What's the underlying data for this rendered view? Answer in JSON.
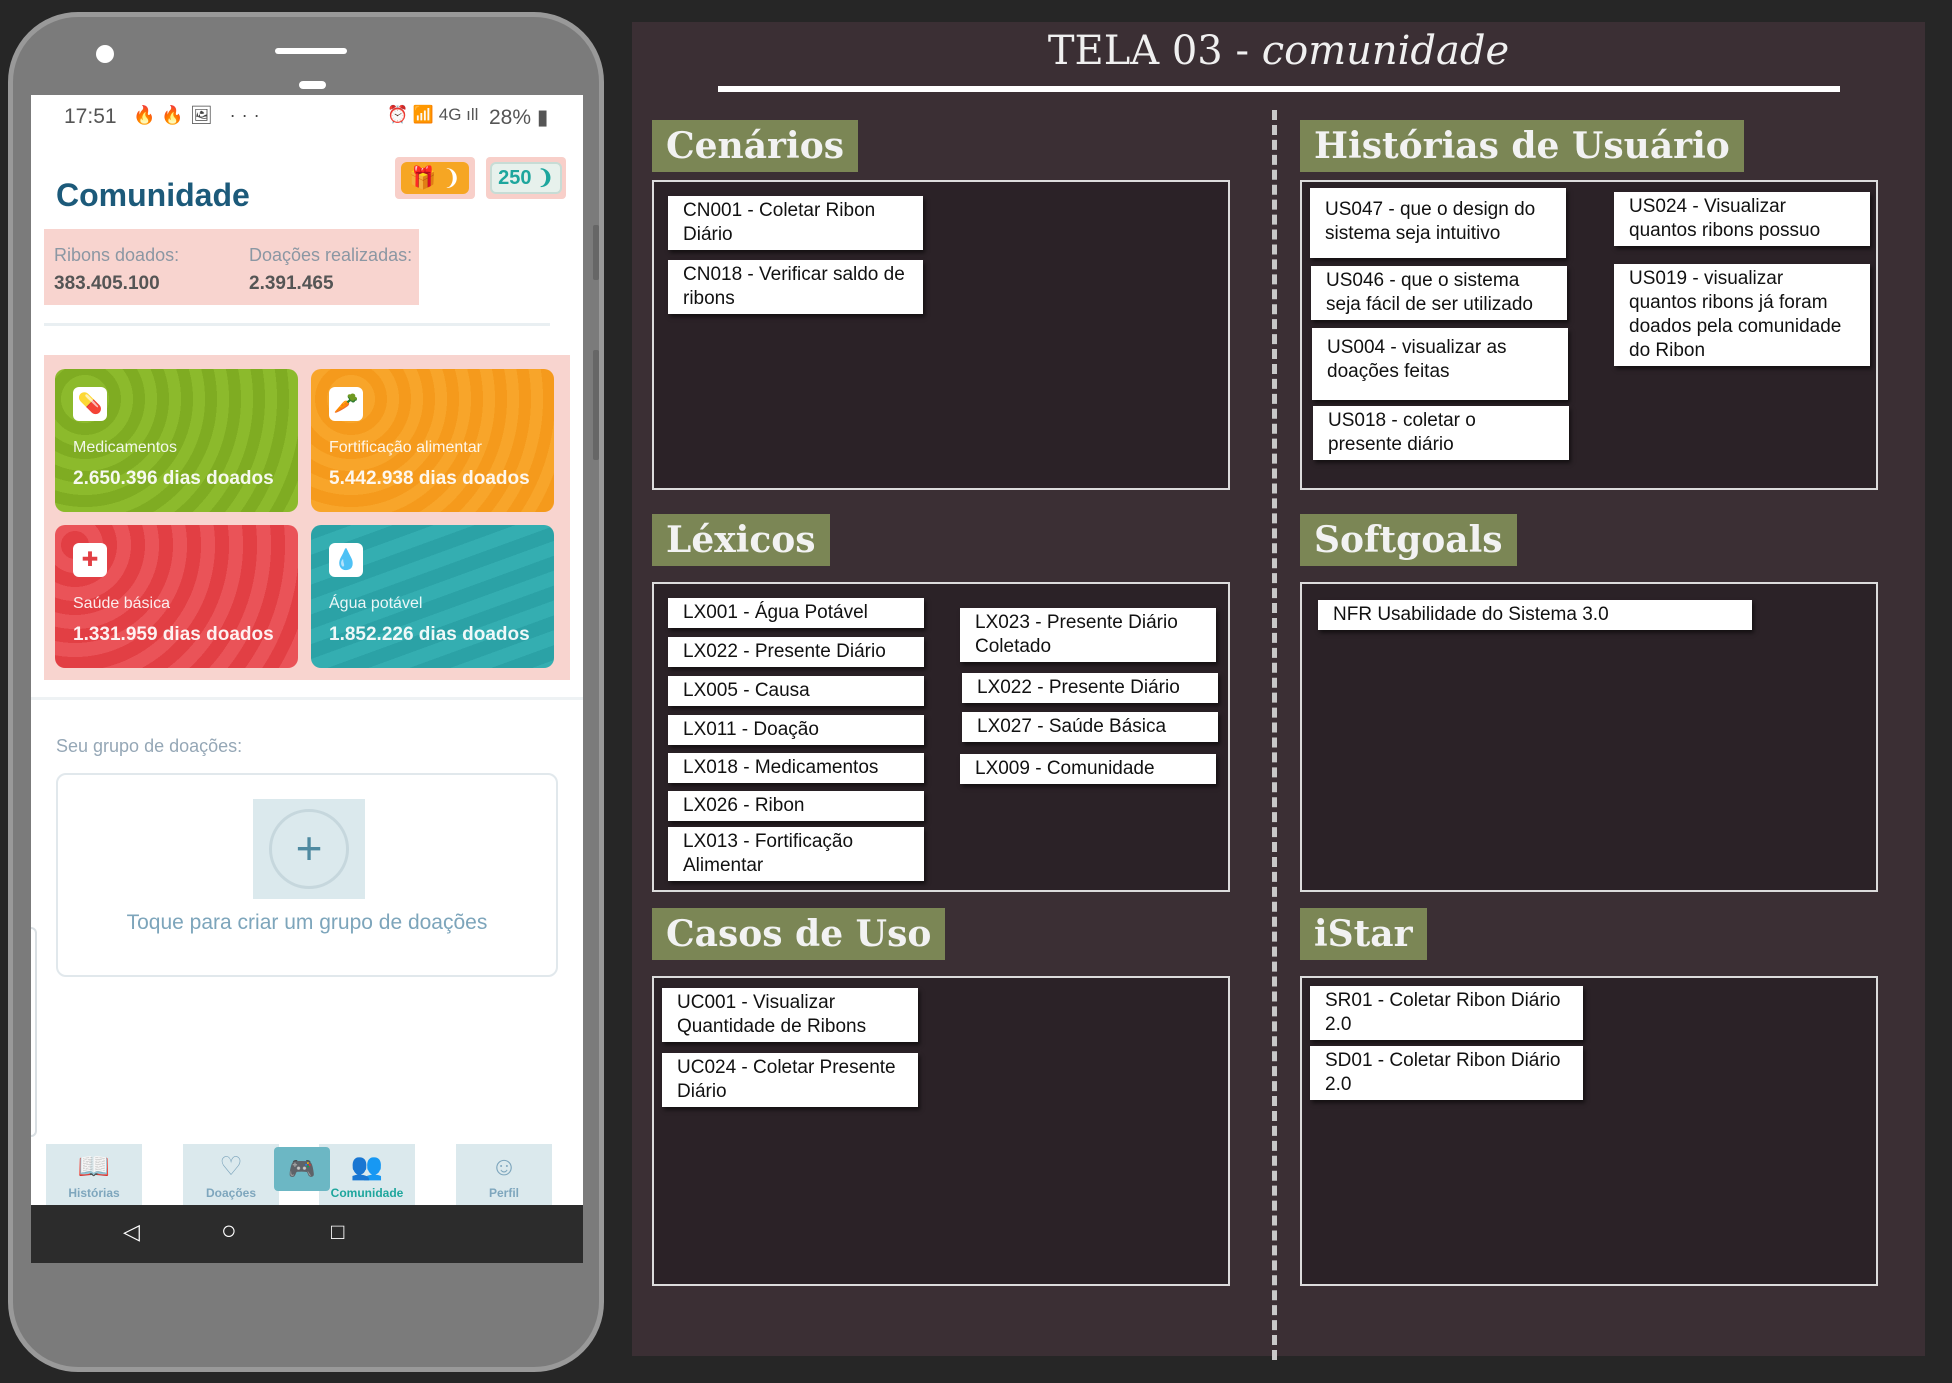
{
  "phone": {
    "status": {
      "time": "17:51",
      "left_icons": "🔥🔥🖼 ···",
      "right_icons": "⏰ 📶 4G ıll",
      "battery": "28%"
    },
    "title": "Comunidade",
    "gift_badge": "🎁 ❩",
    "ribon_count": "250 ❩",
    "stats": {
      "ribons_label": "Ribons doados:",
      "ribons_value": "383.405.100",
      "donations_label": "Doações realizadas:",
      "donations_value": "2.391.465"
    },
    "cards": [
      {
        "label": "Medicamentos",
        "value": "2.650.396 dias doados",
        "icon": "pill-icon",
        "color": "#7fac22"
      },
      {
        "label": "Fortificação alimentar",
        "value": "5.442.938 dias doados",
        "icon": "food-icon",
        "color": "#f59a1c"
      },
      {
        "label": "Saúde básica",
        "value": "1.331.959 dias doados",
        "icon": "medkit-icon",
        "color": "#e23f44"
      },
      {
        "label": "Água potável",
        "value": "1.852.226 dias doados",
        "icon": "water-drop-icon",
        "color": "#2ba2a6"
      }
    ],
    "group_label": "Seu grupo de doações:",
    "group_hint": "Toque para criar um grupo de doações",
    "tabs": [
      {
        "label": "Histórias",
        "icon": "book-icon"
      },
      {
        "label": "Doações",
        "icon": "heart-icon"
      },
      {
        "label": "Comunidade",
        "icon": "people-icon",
        "active": true
      },
      {
        "label": "Perfil",
        "icon": "face-icon"
      }
    ]
  },
  "board": {
    "title_main": "TELA 03 - ",
    "title_italic": "comunidade",
    "sections": {
      "cenarios": {
        "label": "Cenários",
        "items": [
          "CN001 - Coletar Ribon Diário",
          "CN018 - Verificar saldo de ribons"
        ]
      },
      "historias": {
        "label": "Histórias de Usuário",
        "items": [
          "US047 - que o design do sistema seja intuitivo",
          "US046 - que o sistema seja fácil de ser utilizado",
          "US004 - visualizar as doações feitas",
          "US018 - coletar o presente diário",
          "US024 - Visualizar quantos ribons possuo",
          "US019 - visualizar quantos ribons já foram doados pela comunidade do Ribon"
        ]
      },
      "lexicos": {
        "label": "Léxicos",
        "items": [
          "LX001 - Água Potável",
          "LX022 - Presente Diário",
          "LX005 - Causa",
          "LX011 - Doação",
          "LX018 - Medicamentos",
          "LX026 - Ribon",
          "LX013 - Fortificação Alimentar",
          "LX023 - Presente Diário Coletado",
          "LX022 - Presente Diário",
          "LX027 - Saúde Básica",
          "LX009 - Comunidade"
        ]
      },
      "softgoals": {
        "label": "Softgoals",
        "items": [
          "NFR Usabilidade do Sistema 3.0"
        ]
      },
      "casos": {
        "label": "Casos de Uso",
        "items": [
          "UC001 - Visualizar Quantidade de Ribons",
          "UC024 - Coletar Presente Diário"
        ]
      },
      "istar": {
        "label": "iStar",
        "items": [
          "SR01 - Coletar Ribon Diário 2.0",
          "SD01 - Coletar Ribon Diário 2.0"
        ]
      }
    }
  }
}
